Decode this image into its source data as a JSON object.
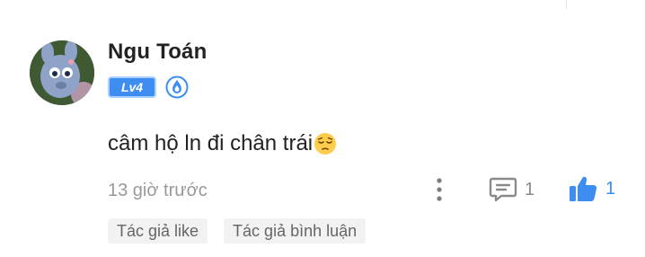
{
  "comment": {
    "author": {
      "name": "Ngu Toán",
      "level": "Lv4",
      "rank_icon": "blue-drop-medal-icon",
      "avatar": "cartoon-blue-cat-avatar"
    },
    "text": "câm hộ ln đi chân trái",
    "emoji": "pensive-face-emoji",
    "time": "13 giờ trước",
    "actions": {
      "more_icon": "vertical-ellipsis-icon",
      "reply_icon": "comment-bubble-icon",
      "reply_count": "1",
      "like_icon": "thumbs-up-icon",
      "like_count": "1",
      "like_color": "#3d8ef0"
    },
    "tags": [
      {
        "label": "Tác giả like"
      },
      {
        "label": "Tác giả bình luận"
      }
    ]
  }
}
